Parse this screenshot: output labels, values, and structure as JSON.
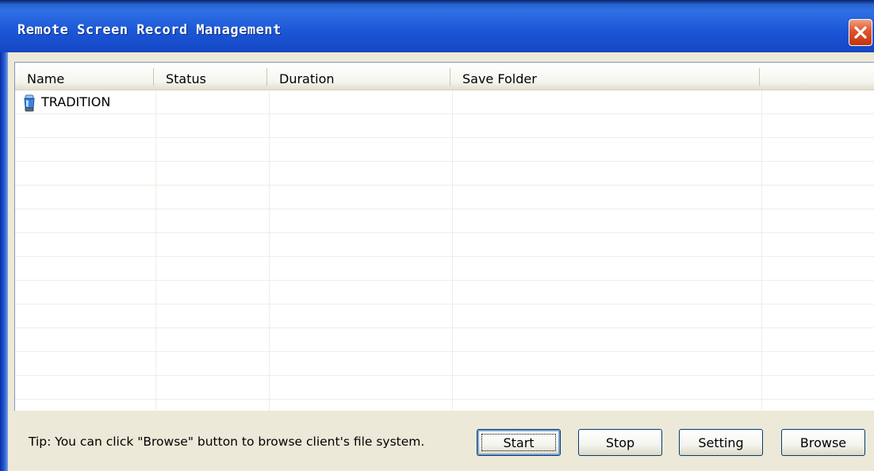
{
  "window": {
    "title": "Remote Screen Record Management",
    "close_icon": "close-icon"
  },
  "list": {
    "columns": [
      "Name",
      "Status",
      "Duration",
      "Save Folder",
      ""
    ],
    "rows": [
      {
        "icon": "client-computer-icon",
        "name": "TRADITION",
        "status": "",
        "duration": "",
        "save_folder": ""
      }
    ]
  },
  "footer": {
    "tip": "Tip: You can click \"Browse\" button to browse client's file system.",
    "buttons": {
      "start": "Start",
      "stop": "Stop",
      "setting": "Setting",
      "browse": "Browse"
    }
  },
  "colors": {
    "titlebar": "#2f6fe4",
    "close_button": "#e0532c",
    "background": "#ece9d8"
  }
}
